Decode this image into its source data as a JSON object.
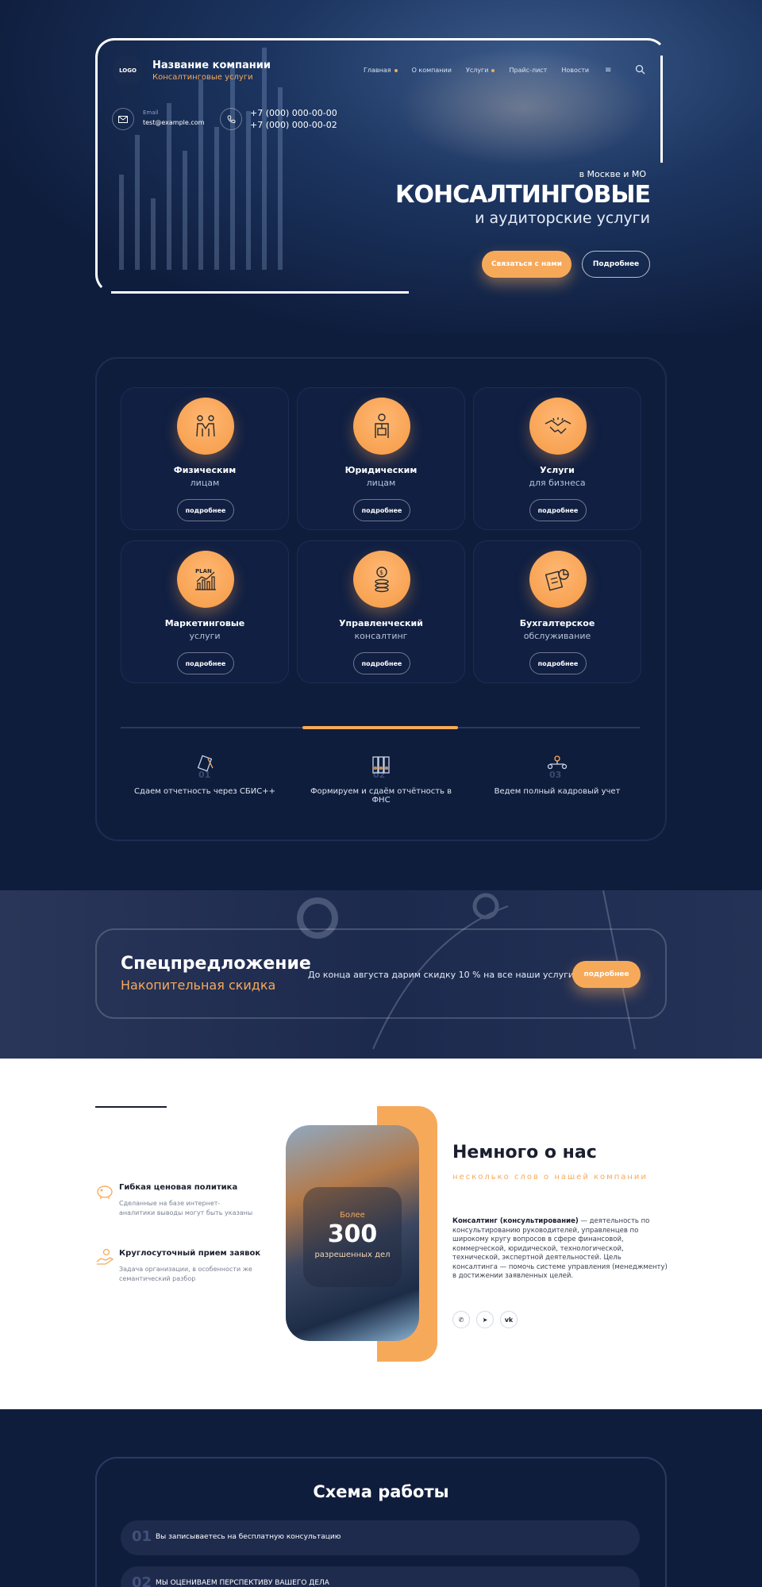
{
  "header": {
    "logo_text": "LOGO",
    "company_name": "Название компании",
    "company_tagline": "Консалтинговые услуги",
    "nav": [
      {
        "label": "Главная",
        "dot": true
      },
      {
        "label": "О компании",
        "dot": false
      },
      {
        "label": "Услуги",
        "dot": true
      },
      {
        "label": "Прайс-лист",
        "dot": false
      },
      {
        "label": "Новости",
        "dot": false
      }
    ],
    "menu_icon": "menu-icon",
    "search_icon": "search-icon",
    "email_label": "Email",
    "email": "test@example.com",
    "phone1": "+7 (000) 000-00-00",
    "phone2": "+7 (000) 000-00-02"
  },
  "hero": {
    "location": "в Москве и МО",
    "title": "КОНСАЛТИНГОВЫЕ",
    "subtitle": "и аудиторские услуги",
    "contact_button": "Связаться с нами",
    "more_button": "Подробнее"
  },
  "services": [
    {
      "title": "Физическим",
      "subtitle": "лицам",
      "button": "подробнее",
      "icon": "handshake-people-icon"
    },
    {
      "title": "Юридическим",
      "subtitle": "лицам",
      "button": "подробнее",
      "icon": "businessman-icon"
    },
    {
      "title": "Услуги",
      "subtitle": "для бизнеса",
      "button": "подробнее",
      "icon": "handshake-icon"
    },
    {
      "title": "Маркетинговые",
      "subtitle": "услуги",
      "button": "подробнее",
      "icon": "plan-chart-icon",
      "icon_text": "PLAN"
    },
    {
      "title": "Управленческий",
      "subtitle": "консалтинг",
      "button": "подробнее",
      "icon": "coins-icon"
    },
    {
      "title": "Бухгалтерское",
      "subtitle": "обслуживание",
      "button": "подробнее",
      "icon": "accounting-icon"
    }
  ],
  "slider_progress": 0.333,
  "features": [
    {
      "number": "01",
      "text": "Сдаем отчетность через СБИС++",
      "icon": "document-pen-icon"
    },
    {
      "number": "02",
      "text": "Формируем и сдаём отчётность в ФНС",
      "icon": "binders-icon"
    },
    {
      "number": "03",
      "text": "Ведем полный кадровый учет",
      "icon": "team-structure-icon"
    }
  ],
  "special": {
    "title": "Спецпредложение",
    "subtitle": "Накопительная скидка",
    "text": "До конца августа дарим скидку 10 % на все наши услуги.",
    "button": "подробнее"
  },
  "about": {
    "features": [
      {
        "title": "Гибкая ценовая политика",
        "desc": "Сделанные на базе интернет-аналитики выводы могут быть указаны",
        "icon": "piggy-bank-icon"
      },
      {
        "title": "Круглосуточный прием заявок",
        "desc": "Задача организации, в особенности же семантический разбор",
        "icon": "hand-coin-icon"
      }
    ],
    "stat_label": "Более",
    "stat_number": "300",
    "stat_caption": "разрешенных дел",
    "title": "Немного о нас",
    "subtitle": "несколько слов о нашей компании",
    "text_bold": "Консалтинг (консультирование)",
    "text_rest": " — деятельность по консультированию руководителей, управленцев по широкому кругу вопросов в сфере финансовой, коммерческой, юридической, технологической, технической, экспертной деятельностей. Цель консалтинга — помочь системе управления (менеджменту) в достижении заявленных целей.",
    "social": [
      {
        "icon": "whatsapp-icon",
        "glyph": "✆"
      },
      {
        "icon": "telegram-icon",
        "glyph": "➤"
      },
      {
        "icon": "vk-icon",
        "glyph": "vk"
      }
    ]
  },
  "scheme": {
    "title": "Схема работы",
    "steps": [
      {
        "number": "01",
        "text": "Вы записываетесь на бесплатную консультацию"
      },
      {
        "number": "02",
        "text": "МЫ ОЦЕНИВАЕМ ПЕРСПЕКТИВУ ВАШЕГО ДЕЛА"
      }
    ]
  },
  "colors": {
    "accent": "#f7a95a",
    "navy": "#0f1d3d",
    "panel_border": "#1d2d52"
  }
}
